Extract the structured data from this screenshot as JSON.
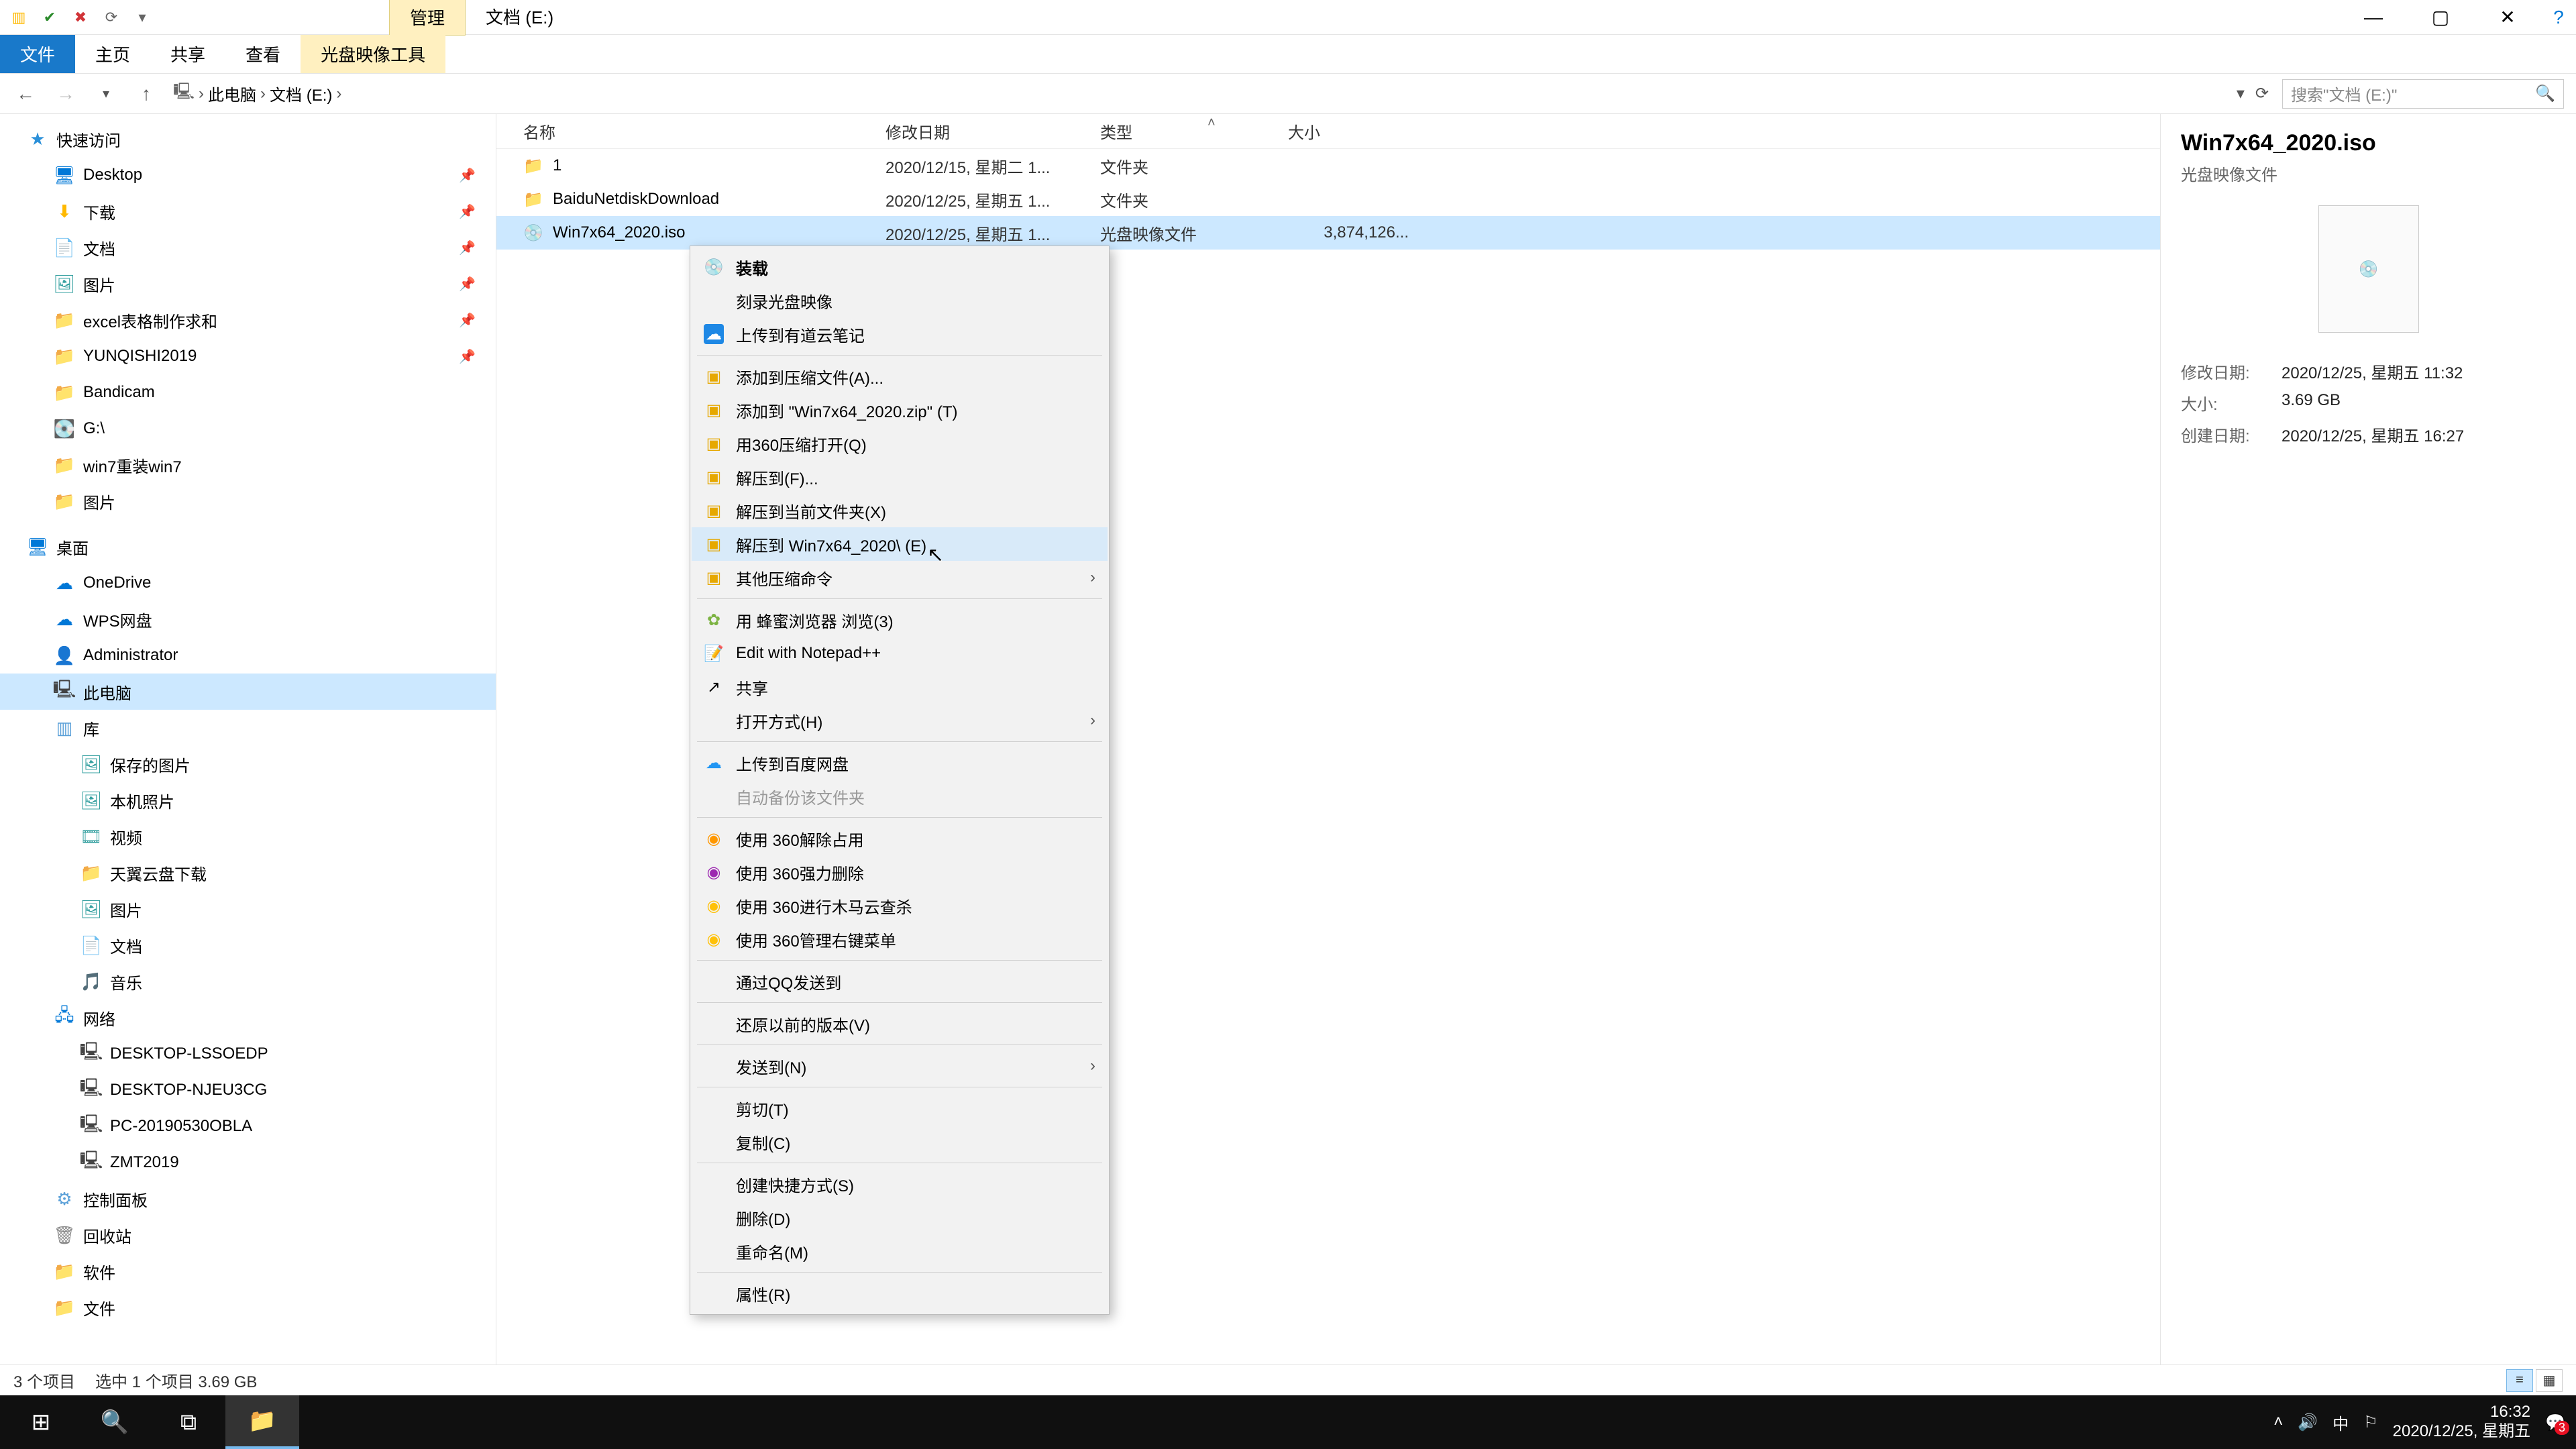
{
  "title_tabs": {
    "manage": "管理",
    "location": "文档 (E:)"
  },
  "window": {
    "minimize": "—",
    "maximize": "▢",
    "close": "✕"
  },
  "ribbon": {
    "file": "文件",
    "home": "主页",
    "share": "共享",
    "view": "查看",
    "iso_tools": "光盘映像工具"
  },
  "breadcrumb": {
    "root": "此电脑",
    "loc": "文档 (E:)"
  },
  "search": {
    "placeholder": "搜索\"文档 (E:)\""
  },
  "tree": {
    "quick_access": "快速访问",
    "desktop": "Desktop",
    "downloads": "下载",
    "documents": "文档",
    "pictures": "图片",
    "excel": "excel表格制作求和",
    "yunqishi": "YUNQISHI2019",
    "bandicam": "Bandicam",
    "gdrive": "G:\\",
    "win7reinstall": "win7重装win7",
    "pictures2": "图片",
    "desktop_zh": "桌面",
    "onedrive": "OneDrive",
    "wps": "WPS网盘",
    "admin": "Administrator",
    "this_pc": "此电脑",
    "libraries": "库",
    "saved_pictures": "保存的图片",
    "camera_roll": "本机照片",
    "videos_lib": "视频",
    "tianyi": "天翼云盘下载",
    "pictures_lib": "图片",
    "documents_lib": "文档",
    "music_lib": "音乐",
    "network": "网络",
    "pc1": "DESKTOP-LSSOEDP",
    "pc2": "DESKTOP-NJEU3CG",
    "pc3": "PC-20190530OBLA",
    "pc4": "ZMT2019",
    "control_panel": "控制面板",
    "recycle": "回收站",
    "software": "软件",
    "files": "文件"
  },
  "columns": {
    "name": "名称",
    "date": "修改日期",
    "type": "类型",
    "size": "大小"
  },
  "rows": [
    {
      "name": "1",
      "date": "2020/12/15, 星期二 1...",
      "type": "文件夹",
      "size": "",
      "icon": "folder"
    },
    {
      "name": "BaiduNetdiskDownload",
      "date": "2020/12/25, 星期五 1...",
      "type": "文件夹",
      "size": "",
      "icon": "folder"
    },
    {
      "name": "Win7x64_2020.iso",
      "date": "2020/12/25, 星期五 1...",
      "type": "光盘映像文件",
      "size": "3,874,126...",
      "icon": "iso",
      "selected": true
    }
  ],
  "context_menu": {
    "mount": "装载",
    "burn": "刻录光盘映像",
    "youdao": "上传到有道云笔记",
    "add_archive": "添加到压缩文件(A)...",
    "add_zip": "添加到 \"Win7x64_2020.zip\" (T)",
    "open_360zip": "用360压缩打开(Q)",
    "extract_to": "解压到(F)...",
    "extract_here": "解压到当前文件夹(X)",
    "extract_named": "解压到 Win7x64_2020\\ (E)",
    "other_compress": "其他压缩命令",
    "bee_browser": "用 蜂蜜浏览器 浏览(3)",
    "notepad": "Edit with Notepad++",
    "share": "共享",
    "open_with": "打开方式(H)",
    "baidu_upload": "上传到百度网盘",
    "auto_backup": "自动备份该文件夹",
    "unlock_360": "使用 360解除占用",
    "force_del_360": "使用 360强力删除",
    "trojan_360": "使用 360进行木马云查杀",
    "manage_menu_360": "使用 360管理右键菜单",
    "qq_send": "通过QQ发送到",
    "restore_prev": "还原以前的版本(V)",
    "send_to": "发送到(N)",
    "cut": "剪切(T)",
    "copy": "复制(C)",
    "shortcut": "创建快捷方式(S)",
    "delete": "删除(D)",
    "rename": "重命名(M)",
    "properties": "属性(R)"
  },
  "details": {
    "filename": "Win7x64_2020.iso",
    "filetype": "光盘映像文件",
    "mod_label": "修改日期:",
    "mod_value": "2020/12/25, 星期五 11:32",
    "size_label": "大小:",
    "size_value": "3.69 GB",
    "created_label": "创建日期:",
    "created_value": "2020/12/25, 星期五 16:27"
  },
  "statusbar": {
    "count": "3 个项目",
    "selection": "选中 1 个项目  3.69 GB"
  },
  "taskbar": {
    "ime": "中",
    "time": "16:32",
    "date": "2020/12/25, 星期五",
    "badge": "3"
  }
}
